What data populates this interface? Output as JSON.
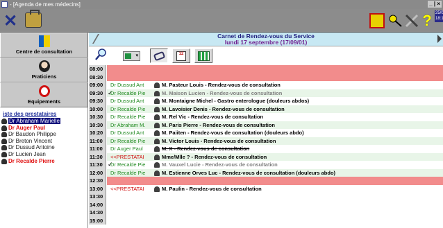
{
  "window": {
    "title": "- [Agenda de mes médecins]",
    "buttons": "_ | ×"
  },
  "clock": {
    "date": "25/09/0",
    "time": "18:1"
  },
  "nav": {
    "consultation": "Centre de consultation",
    "praticiens": "Praticiens",
    "equipements": "Equipements"
  },
  "prestataires": {
    "title": "iste des prestataires",
    "items": [
      {
        "name": "Dr Abraham Marielle",
        "style": "sel"
      },
      {
        "name": "Dr Auger Paul",
        "style": "red"
      },
      {
        "name": "Dr Baudon Philippe",
        "style": ""
      },
      {
        "name": "Dr Breton Vincent",
        "style": ""
      },
      {
        "name": "Dr Dussud Antoine",
        "style": ""
      },
      {
        "name": "Dr Lucien Jean",
        "style": ""
      },
      {
        "name": "Dr Recalde Pierre",
        "style": "red"
      }
    ]
  },
  "header": {
    "title": "Carnet de Rendez-vous du Service",
    "date": "lundi 17 septembre (17/09/01)"
  },
  "agenda": [
    {
      "time": "08:00",
      "kind": "closed",
      "check": "",
      "prest": "",
      "desc": "",
      "done": false,
      "strike": false,
      "ext": false
    },
    {
      "time": "08:30",
      "kind": "closed",
      "check": "",
      "prest": "",
      "desc": "",
      "done": false,
      "strike": false,
      "ext": false
    },
    {
      "time": "09:00",
      "kind": "g2",
      "check": "",
      "prest": "Dr Dussud Ant",
      "desc": "M. Pasteur Louis - Rendez-vous de consultation",
      "done": false,
      "strike": false,
      "ext": false
    },
    {
      "time": "09:30",
      "kind": "g1",
      "check": "✓",
      "prest": "Dr Recalde Pie",
      "desc": "M. Maison Lucien - Rendez-vous de consultation",
      "done": true,
      "strike": false,
      "ext": false
    },
    {
      "time": "09:30",
      "kind": "g2",
      "check": "",
      "prest": "Dr Dussud Ant",
      "desc": "M. Montaigne Michel - Gastro enterologue (douleurs abdos)",
      "done": false,
      "strike": false,
      "ext": false
    },
    {
      "time": "10:00",
      "kind": "g1",
      "check": "",
      "prest": "Dr Recalde Pie",
      "desc": "M. Lavoisier Denis - Rendez-vous de consultation",
      "done": false,
      "strike": false,
      "ext": false
    },
    {
      "time": "10:30",
      "kind": "g2",
      "check": "",
      "prest": "Dr Recalde Pie",
      "desc": "M. Rel Vic - Rendez-vous de consultation",
      "done": false,
      "strike": false,
      "ext": false
    },
    {
      "time": "10:30",
      "kind": "g1",
      "check": "",
      "prest": "Dr Abraham M.",
      "desc": "M. Paris Pierre - Rendez-vous de consultation",
      "done": false,
      "strike": false,
      "ext": false
    },
    {
      "time": "10:20",
      "kind": "g2",
      "check": "",
      "prest": "Dr Dussud Ant",
      "desc": "M. Paiiten - Rendez-vous de consultation (douleurs abdo)",
      "done": false,
      "strike": false,
      "ext": false
    },
    {
      "time": "11:00",
      "kind": "g1",
      "check": "",
      "prest": "Dr Recalde Pie",
      "desc": "M. Victor Louis - Rendez-vous de consultation",
      "done": false,
      "strike": false,
      "ext": false
    },
    {
      "time": "11:00",
      "kind": "g2",
      "check": "",
      "prest": "Dr Auger Paul",
      "desc": "M. X - Rendez-vous de consultation",
      "done": false,
      "strike": true,
      "ext": false
    },
    {
      "time": "11:30",
      "kind": "g1",
      "check": "",
      "prest": "<<PRESTATAI",
      "desc": "Mme/Mlle ? - Rendez-vous de consultation",
      "done": false,
      "strike": false,
      "ext": true
    },
    {
      "time": "11:30",
      "kind": "g2",
      "check": "✓",
      "prest": "Dr Recalde Pie",
      "desc": "M. Vauxel Lucie - Rendez-vous de consultation",
      "done": true,
      "strike": false,
      "ext": false
    },
    {
      "time": "12:00",
      "kind": "g1",
      "check": "",
      "prest": "Dr Recalde Pie",
      "desc": "M. Estienne Orves Luc - Rendez-vous de consultation (douleurs abdo)",
      "done": false,
      "strike": false,
      "ext": false
    },
    {
      "time": "12:30",
      "kind": "closed",
      "check": "",
      "prest": "",
      "desc": "",
      "done": false,
      "strike": false,
      "ext": false
    },
    {
      "time": "13:00",
      "kind": "g2",
      "check": "",
      "prest": "<<PRESTATAI",
      "desc": "M. Paulin - Rendez-vous de consultation",
      "done": false,
      "strike": false,
      "ext": true
    },
    {
      "time": "13:30",
      "kind": "g2",
      "check": "",
      "prest": "",
      "desc": "",
      "done": false,
      "strike": false,
      "ext": false
    },
    {
      "time": "14:00",
      "kind": "g2",
      "check": "",
      "prest": "",
      "desc": "",
      "done": false,
      "strike": false,
      "ext": false
    },
    {
      "time": "14:30",
      "kind": "g2",
      "check": "",
      "prest": "",
      "desc": "",
      "done": false,
      "strike": false,
      "ext": false
    },
    {
      "time": "15:00",
      "kind": "g2",
      "check": "",
      "prest": "",
      "desc": "",
      "done": false,
      "strike": false,
      "ext": false
    }
  ]
}
